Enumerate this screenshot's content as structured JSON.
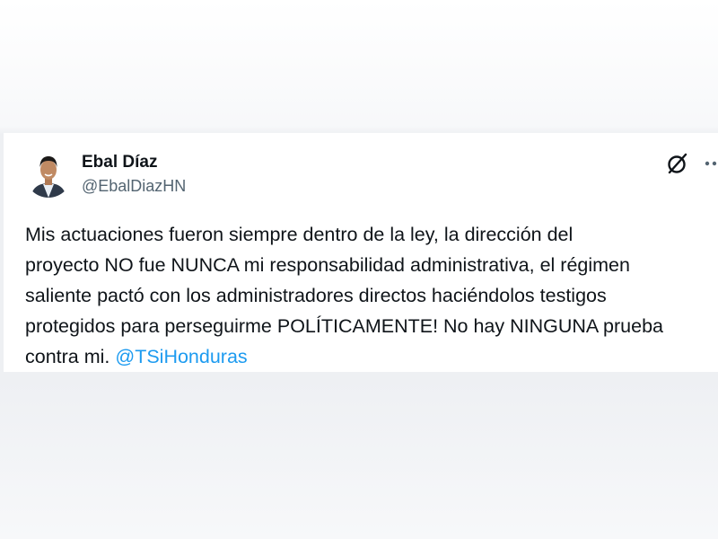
{
  "tweet": {
    "author": {
      "display_name": "Ebal Díaz",
      "handle": "@EbalDiazHN"
    },
    "text_lines": [
      "Mis actuaciones fueron siempre dentro de la ley, la dirección del",
      "proyecto NO fue NUNCA mi responsabilidad administrativa, el régimen",
      "saliente pactó con los administradores directos haciéndolos testigos",
      "protegidos para perseguirme POLÍTICAMENTE! No hay NINGUNA prueba"
    ],
    "last_line_text": "contra mi.",
    "mention": "@TSiHonduras",
    "icons": {
      "grok": "grok-icon",
      "more": "more-options-icon"
    },
    "colors": {
      "text": "#0f1419",
      "secondary": "#536471",
      "link": "#1d9bf0"
    }
  }
}
